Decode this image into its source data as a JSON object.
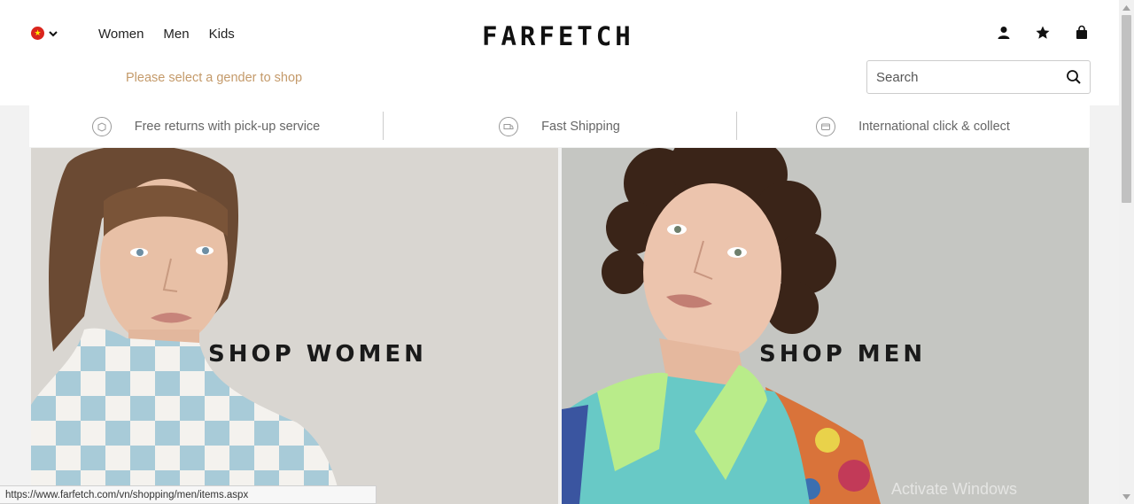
{
  "header": {
    "country_icon": "vietnam-flag-icon",
    "nav": [
      {
        "label": "Women"
      },
      {
        "label": "Men"
      },
      {
        "label": "Kids"
      }
    ],
    "logo": "FARFETCH",
    "gender_hint": "Please select a gender to shop",
    "icons": [
      "account-icon",
      "wishlist-star-icon",
      "bag-icon"
    ],
    "search": {
      "placeholder": "Search",
      "icon": "search-icon"
    }
  },
  "benefits": [
    {
      "label": "Free returns with pick-up service",
      "icon": "box-return-icon"
    },
    {
      "label": "Fast Shipping",
      "icon": "fast-truck-icon"
    },
    {
      "label": "International click & collect",
      "icon": "card-icon"
    }
  ],
  "panels": {
    "women": {
      "label": "SHOP WOMEN"
    },
    "men": {
      "label": "SHOP MEN"
    }
  },
  "status_bar": {
    "url": "https://www.farfetch.com/vn/shopping/men/items.aspx"
  },
  "watermark": "Activate Windows",
  "colors": {
    "hint": "#c49a6a",
    "band": "#f2f2f2",
    "women_bg": "#d9d6d1",
    "men_bg": "#c5c6c2"
  }
}
